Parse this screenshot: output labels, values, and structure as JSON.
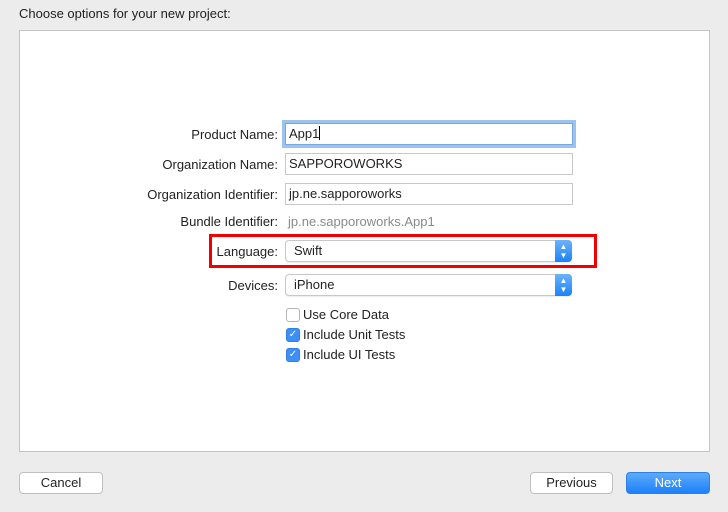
{
  "title": "Choose options for your new project:",
  "form": {
    "product_name": {
      "label": "Product Name:",
      "value": "App1"
    },
    "organization_name": {
      "label": "Organization Name:",
      "value": "SAPPOROWORKS"
    },
    "organization_identifier": {
      "label": "Organization Identifier:",
      "value": "jp.ne.sapporoworks"
    },
    "bundle_identifier": {
      "label": "Bundle Identifier:",
      "value": "jp.ne.sapporoworks.App1"
    },
    "language": {
      "label": "Language:",
      "value": "Swift"
    },
    "devices": {
      "label": "Devices:",
      "value": "iPhone"
    },
    "checkboxes": [
      {
        "label": "Use Core Data",
        "checked": false
      },
      {
        "label": "Include Unit Tests",
        "checked": true
      },
      {
        "label": "Include UI Tests",
        "checked": true
      }
    ]
  },
  "buttons": {
    "cancel": "Cancel",
    "previous": "Previous",
    "next": "Next"
  },
  "colors": {
    "highlight": "#f20000",
    "accent": "#1b81fb"
  }
}
